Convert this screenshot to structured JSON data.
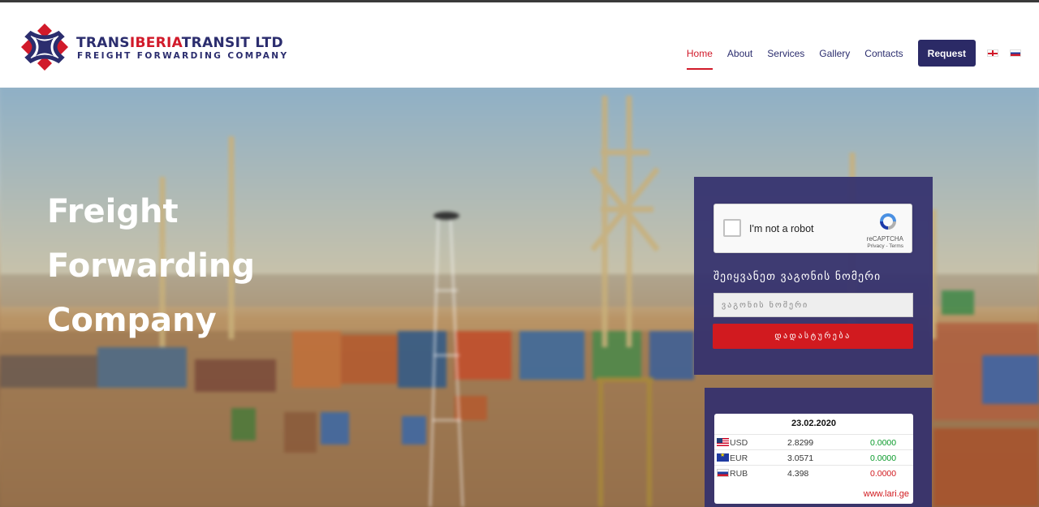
{
  "header": {
    "logo": {
      "title_part1": "TRANS",
      "title_accent": "IBERIA",
      "title_part2": "TRANSIT LTD",
      "subtitle": "FREIGHT FORWARDING COMPANY"
    },
    "nav": {
      "items": [
        {
          "label": "Home",
          "active": true
        },
        {
          "label": "About",
          "active": false
        },
        {
          "label": "Services",
          "active": false
        },
        {
          "label": "Gallery",
          "active": false
        },
        {
          "label": "Contacts",
          "active": false
        }
      ],
      "request_label": "Request",
      "languages": [
        "georgian-flag-icon",
        "russian-flag-icon"
      ]
    }
  },
  "hero": {
    "title_line1": "Freight Forwarding",
    "title_line2": "Company"
  },
  "wagon_form": {
    "captcha": {
      "label": "I'm not a robot",
      "brand": "reCAPTCHA",
      "links": "Privacy - Terms"
    },
    "heading": "შეიყვანეთ ვაგონის ნომერი",
    "input_placeholder": "ვაგონის ნომერი",
    "input_value": "",
    "submit_label": "დადასტურება"
  },
  "exchange_rates": {
    "date": "23.02.2020",
    "rows": [
      {
        "code": "USD",
        "flag": "us-flag-icon",
        "rate": "2.8299",
        "change": "0.0000",
        "change_color": "#0a9a2a"
      },
      {
        "code": "EUR",
        "flag": "eu-flag-icon",
        "rate": "3.0571",
        "change": "0.0000",
        "change_color": "#0a9a2a"
      },
      {
        "code": "RUB",
        "flag": "ru-flag-icon",
        "rate": "4.398",
        "change": "0.0000",
        "change_color": "#d11a1f"
      }
    ],
    "source_link": "www.lari.ge"
  },
  "colors": {
    "brand_navy": "#2b2d6e",
    "brand_red": "#d11a2a",
    "panel_bg": "#34306e"
  }
}
